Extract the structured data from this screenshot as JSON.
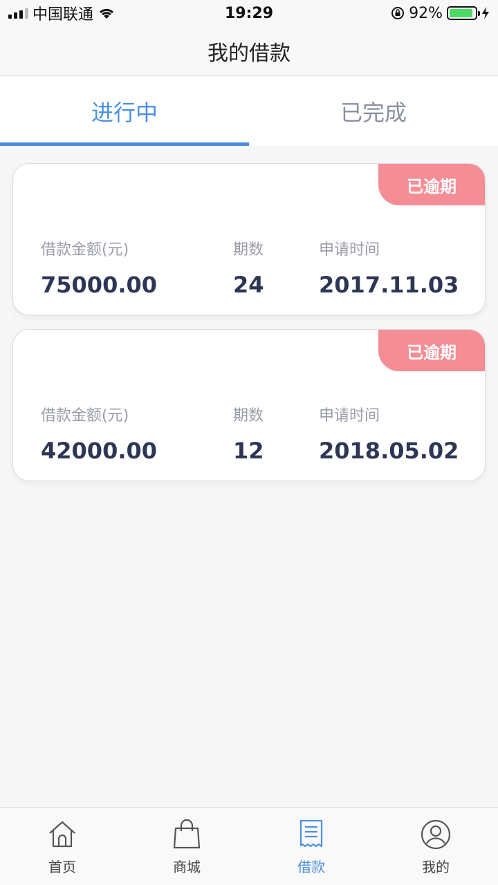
{
  "status_bar": {
    "carrier": "中国联通",
    "time": "19:29",
    "battery_percent": "92%",
    "battery_level": 0.92
  },
  "header": {
    "title": "我的借款"
  },
  "tabs": [
    {
      "label": "进行中",
      "active": true
    },
    {
      "label": "已完成",
      "active": false
    }
  ],
  "loans": [
    {
      "badge": "已逾期",
      "amount_label": "借款金额(元)",
      "amount": "75000.00",
      "period_label": "期数",
      "period": "24",
      "date_label": "申请时间",
      "date": "2017.11.03"
    },
    {
      "badge": "已逾期",
      "amount_label": "借款金额(元)",
      "amount": "42000.00",
      "period_label": "期数",
      "period": "12",
      "date_label": "申请时间",
      "date": "2018.05.02"
    }
  ],
  "tabbar": [
    {
      "label": "首页",
      "icon": "home-icon",
      "active": false
    },
    {
      "label": "商城",
      "icon": "shopping-bag-icon",
      "active": false
    },
    {
      "label": "借款",
      "icon": "receipt-icon",
      "active": true
    },
    {
      "label": "我的",
      "icon": "user-icon",
      "active": false
    }
  ],
  "colors": {
    "accent": "#4a8fe2",
    "badge": "#f48d95",
    "value_text": "#2e3656",
    "label_text": "#999ca8"
  }
}
